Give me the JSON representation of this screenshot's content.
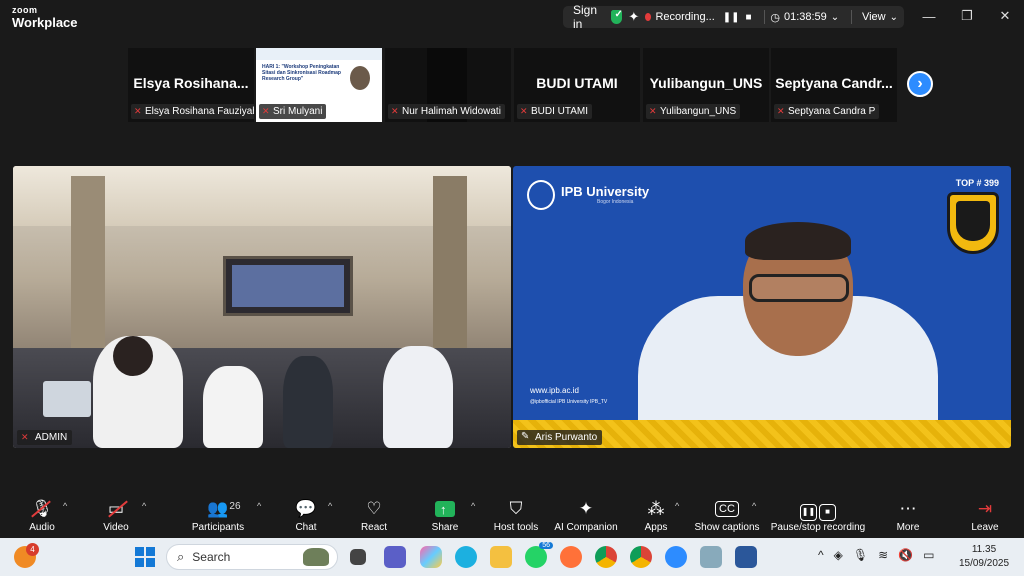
{
  "app": {
    "brand_top": "zoom",
    "brand_bottom": "Workplace"
  },
  "topbar": {
    "signin": "Sign in",
    "recording_label": "Recording...",
    "timer": "01:38:59",
    "view": "View"
  },
  "window_controls": {
    "minimize": "—",
    "restore": "❐",
    "close": "✕"
  },
  "strip": {
    "tiles": [
      {
        "display_name": "Elsya  Rosihana...",
        "label": "Elsya Rosihana Fauziyah"
      },
      {
        "display_name": "",
        "label": "Sri Mulyani",
        "slide_text": "HARI 1: \"Workshop Peningkatan Sitasi dan Sinkronisasi Roadmap Research Group\""
      },
      {
        "display_name": "",
        "label": "Nur Halimah Widowati"
      },
      {
        "display_name": "BUDI UTAMI",
        "label": "BUDI UTAMI"
      },
      {
        "display_name": "Yulibangun_UNS",
        "label": "Yulibangun_UNS"
      },
      {
        "display_name": "Septyana  Candr...",
        "label": "Septyana Candra P"
      }
    ],
    "next_icon": "›"
  },
  "main": {
    "left": {
      "label": "ADMIN"
    },
    "right": {
      "label": "Aris Purwanto",
      "org_name": "IPB University",
      "org_sub": "Bogor Indonesia",
      "rank": "TOP # 399",
      "url": "www.ipb.ac.id",
      "socials": "@ipbofficial   IPB University   IPB_TV"
    }
  },
  "toolbar": {
    "audio": "Audio",
    "video": "Video",
    "participants": "Participants",
    "participants_count": "26",
    "chat": "Chat",
    "react": "React",
    "share": "Share",
    "host_tools": "Host tools",
    "ai_companion": "AI Companion",
    "apps": "Apps",
    "captions": "Show captions",
    "captions_icon": "CC",
    "recording": "Pause/stop recording",
    "more": "More",
    "leave": "Leave"
  },
  "taskbar": {
    "weather_badge": "4",
    "search_placeholder": "Search",
    "whatsapp_badge": "56",
    "time": "11.35",
    "date": "15/09/2025"
  },
  "colors": {
    "accent": "#2d8cff",
    "record": "#e23b3b",
    "share": "#22b35a",
    "ipb_blue": "#1e4fae",
    "ipb_gold": "#f2b90f"
  }
}
